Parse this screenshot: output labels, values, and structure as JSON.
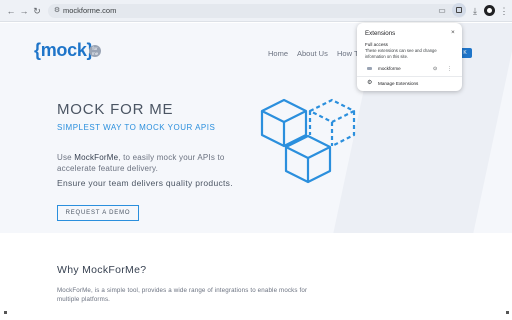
{
  "browser": {
    "url": "mockforme.com",
    "icons": {
      "back": "back-arrow-icon",
      "forward": "forward-arrow-icon",
      "reload": "reload-icon",
      "site_info": "tune-icon",
      "cast": "cast-icon",
      "bookmark": "star-icon",
      "extensions": "puzzle-icon",
      "download": "download-icon",
      "profile": "avatar-icon",
      "menu": "kebab-menu-icon"
    }
  },
  "site": {
    "logo_text": "{mock}",
    "logo_badge": "for me",
    "nav": [
      "Home",
      "About Us",
      "How T"
    ],
    "nav_cta": "K",
    "brand_color": "#1f75c9",
    "accent_color": "#2b8fdd"
  },
  "hero": {
    "title": "MOCK FOR ME",
    "subtitle": "SIMPLEST WAY TO MOCK YOUR APIS",
    "body_prefix": "Use ",
    "body_brand": "MockForMe",
    "body_suffix": ", to easily mock your APIs to accelerate feature delivery.",
    "tagline": "Ensure your team delivers quality products.",
    "cta": "REQUEST A DEMO"
  },
  "why": {
    "title": "Why MockForMe?",
    "body": "MockForMe, is a simple tool, provides a wide range of integrations to enable mocks for multiple platforms."
  },
  "extensions_popup": {
    "title": "Extensions",
    "close": "×",
    "section": "Full access",
    "description": "These extensions can see and change information on this site.",
    "items": [
      {
        "name": "mockforme",
        "icon": "mockforme-extension-icon"
      }
    ],
    "manage_label": "Manage Extensions"
  }
}
